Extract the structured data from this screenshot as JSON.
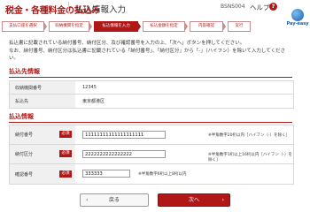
{
  "header": {
    "title": "税金・各種料金の払込み",
    "subtitle": "払込情報入力",
    "screen_code": "BSNS004",
    "help_label": "ヘルプ",
    "help_symbol": "?",
    "logo_text": "Pay-easy"
  },
  "steps": [
    {
      "label": "支払口座を選択"
    },
    {
      "label": "収納機関を指定"
    },
    {
      "label": "払込情報を入力"
    },
    {
      "label": "払込金額を指定"
    },
    {
      "label": "内容確認"
    },
    {
      "label": "実行"
    }
  ],
  "active_step_index": 2,
  "intro": {
    "line1": "払込書に記載されている納付番号、納付区分、及び確認番号を入力の上、「次へ」ボタンを押してください。",
    "line2": "なお、納付番号、納付区分は払込書に記載されている「納付番号」、「納付区分」から「-」（ハイフン）を除いて入力してください。"
  },
  "payee_section": {
    "title": "払込先情報",
    "rows": [
      {
        "label": "収納機関番号",
        "value": "12345"
      },
      {
        "label": "払込先",
        "value": "東京都港区"
      }
    ]
  },
  "payment_section": {
    "title": "払込情報",
    "required_label": "必須",
    "fields": [
      {
        "label": "納付番号",
        "value": "11111111111111111111",
        "hint": "※半角数字20桁以内［ハイフン（-）を除く］"
      },
      {
        "label": "納付区分",
        "value": "2222222222222222",
        "hint": "※半角数字1桁以上16桁以内［ハイフン（-）を除く］"
      },
      {
        "label": "確認番号",
        "value": "333333",
        "hint": "※半角数字6桁以上8桁以内"
      }
    ]
  },
  "buttons": {
    "back_label": "戻る",
    "next_label": "次へ"
  },
  "colors": {
    "accent": "#b01818",
    "label_bg": "#f0f0f0"
  }
}
